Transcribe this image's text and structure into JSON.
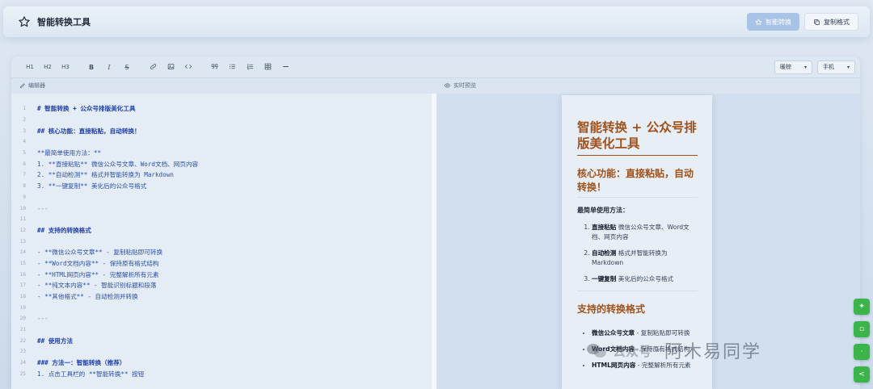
{
  "header": {
    "title": "智能转换工具",
    "convert_label": "智能转换",
    "copy_label": "复制格式"
  },
  "toolbar": {
    "h1": "H1",
    "h2": "H2",
    "h3": "H3",
    "bold": "B",
    "italic": "I",
    "strike": "S",
    "theme_select": "暖棕",
    "device_select": "手机"
  },
  "panes": {
    "editor_label": "编辑器",
    "preview_label": "实时预览"
  },
  "editor_lines": [
    {
      "n": "1",
      "t": "# 智能转换 + 公众号排版美化工具",
      "s": "h"
    },
    {
      "n": "2",
      "t": "",
      "s": ""
    },
    {
      "n": "3",
      "t": "## 核心功能：直接粘贴，自动转换！",
      "s": "h"
    },
    {
      "n": "4",
      "t": "",
      "s": ""
    },
    {
      "n": "5",
      "t": "**最简单使用方法：**",
      "s": ""
    },
    {
      "n": "6",
      "t": "1. **直接粘贴** 微信公众号文章、Word文档、网页内容",
      "s": ""
    },
    {
      "n": "7",
      "t": "2. **自动检测** 格式并智能转换为 Markdown",
      "s": ""
    },
    {
      "n": "8",
      "t": "3. **一键复制** 美化后的公众号格式",
      "s": ""
    },
    {
      "n": "9",
      "t": "",
      "s": ""
    },
    {
      "n": "10",
      "t": "---",
      "s": "dim"
    },
    {
      "n": "11",
      "t": "",
      "s": ""
    },
    {
      "n": "12",
      "t": "## 支持的转换格式",
      "s": "h"
    },
    {
      "n": "13",
      "t": "",
      "s": ""
    },
    {
      "n": "14",
      "t": "- **微信公众号文章** - 复制粘贴即可转换",
      "s": ""
    },
    {
      "n": "15",
      "t": "- **Word文档内容** - 保持原有格式结构",
      "s": ""
    },
    {
      "n": "16",
      "t": "- **HTML网页内容** - 完整解析所有元素",
      "s": ""
    },
    {
      "n": "17",
      "t": "- **纯文本内容** - 智能识别标题和段落",
      "s": ""
    },
    {
      "n": "18",
      "t": "- **其他格式** - 自动检测并转换",
      "s": ""
    },
    {
      "n": "19",
      "t": "",
      "s": ""
    },
    {
      "n": "20",
      "t": "---",
      "s": "dim"
    },
    {
      "n": "21",
      "t": "",
      "s": ""
    },
    {
      "n": "22",
      "t": "## 使用方法",
      "s": "h"
    },
    {
      "n": "23",
      "t": "",
      "s": ""
    },
    {
      "n": "24",
      "t": "### 方法一：智能转换（推荐）",
      "s": "h"
    },
    {
      "n": "25",
      "t": "1. 点击工具栏的 **智能转换** 按钮",
      "s": ""
    }
  ],
  "preview": {
    "h1": "智能转换 + 公众号排版美化工具",
    "h2_core": "核心功能：直接粘贴，自动转换！",
    "simplest": "最简单使用方法：",
    "steps": [
      {
        "b": "直接粘贴",
        "t": " 微信公众号文章、Word文档、网页内容"
      },
      {
        "b": "自动检测",
        "t": " 格式并智能转换为 Markdown"
      },
      {
        "b": "一键复制",
        "t": " 美化后的公众号格式"
      }
    ],
    "h2_formats": "支持的转换格式",
    "formats": [
      {
        "b": "微信公众号文章",
        "t": " - 复制粘贴即可转换"
      },
      {
        "b": "Word文档内容",
        "t": " - 保持原有格式结构"
      },
      {
        "b": "HTML网页内容",
        "t": " - 完整解析所有元素"
      }
    ]
  },
  "watermark": {
    "prefix": "公众号",
    "name": "阿木易同学"
  },
  "colors": {
    "accent": "#a0511a",
    "primary_button": "#a9c3e6",
    "fab": "#3bb54a"
  }
}
